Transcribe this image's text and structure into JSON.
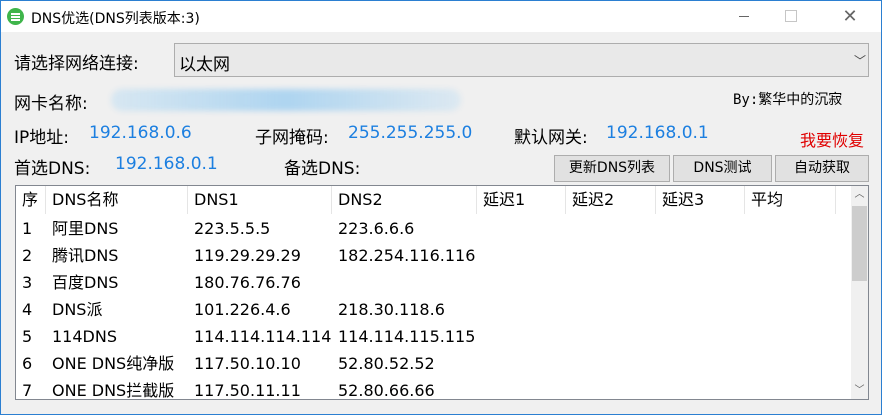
{
  "window": {
    "title": "DNS优选(DNS列表版本:3)"
  },
  "icons": {
    "app": "app-icon",
    "minimize": "minimize-icon",
    "maximize": "maximize-icon",
    "close": "close-icon"
  },
  "connection": {
    "label": "请选择网络连接:",
    "selected": "以太网"
  },
  "adapter": {
    "label": "网卡名称:",
    "author": "By:繁华中的沉寂"
  },
  "network": {
    "ip_label": "IP地址:",
    "ip_value": "192.168.0.6",
    "mask_label": "子网掩码:",
    "mask_value": "255.255.255.0",
    "gateway_label": "默认网关:",
    "gateway_value": "192.168.0.1",
    "restore_link": "我要恢复",
    "primary_dns_label": "首选DNS:",
    "primary_dns_value": "192.168.0.1",
    "secondary_dns_label": "备选DNS:"
  },
  "buttons": {
    "update": "更新DNS列表",
    "test": "DNS测试",
    "auto": "自动获取"
  },
  "table": {
    "headers": [
      "序",
      "DNS名称",
      "DNS1",
      "DNS2",
      "延迟1",
      "延迟2",
      "延迟3",
      "平均"
    ],
    "rows": [
      [
        "1",
        "阿里DNS",
        "223.5.5.5",
        "223.6.6.6",
        "",
        "",
        "",
        ""
      ],
      [
        "2",
        "腾讯DNS",
        "119.29.29.29",
        "182.254.116.116",
        "",
        "",
        "",
        ""
      ],
      [
        "3",
        "百度DNS",
        "180.76.76.76",
        "",
        "",
        "",
        "",
        ""
      ],
      [
        "4",
        "DNS派",
        "101.226.4.6",
        "218.30.118.6",
        "",
        "",
        "",
        ""
      ],
      [
        "5",
        "114DNS",
        "114.114.114.114",
        "114.114.115.115",
        "",
        "",
        "",
        ""
      ],
      [
        "6",
        "ONE DNS纯净版",
        "117.50.10.10",
        "52.80.52.52",
        "",
        "",
        "",
        ""
      ],
      [
        "7",
        "ONE DNS拦截版",
        "117.50.11.11",
        "52.80.66.66",
        "",
        "",
        "",
        ""
      ]
    ]
  },
  "colors": {
    "accent": "#1c7fe0",
    "restore": "#e00000"
  }
}
